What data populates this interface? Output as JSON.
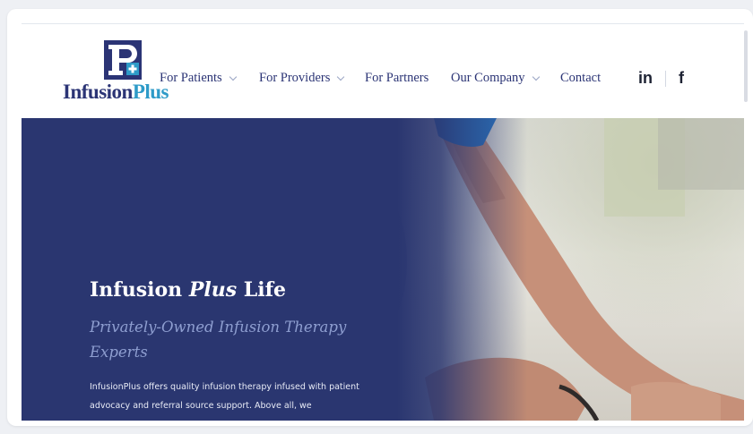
{
  "logo": {
    "name_part1": "Infusion",
    "name_part2": "Plus",
    "colors": {
      "navy": "#2b3475",
      "teal": "#2e9bc8"
    }
  },
  "nav": {
    "items": [
      {
        "label": "For Patients",
        "has_dropdown": true
      },
      {
        "label": "For Providers",
        "has_dropdown": true
      },
      {
        "label": "For Partners",
        "has_dropdown": false
      },
      {
        "label": "Our Company",
        "has_dropdown": true
      },
      {
        "label": "Contact",
        "has_dropdown": false
      }
    ]
  },
  "social": {
    "linkedin_label": "in",
    "facebook_label": "f",
    "icons": [
      "linkedin-icon",
      "facebook-icon"
    ]
  },
  "hero": {
    "title_before": "Infusion ",
    "title_emphasis": "Plus",
    "title_after": " Life",
    "subtitle": "Privately-Owned Infusion Therapy Experts",
    "body": "InfusionPlus offers quality infusion therapy infused with patient advocacy and referral source support. Above all, we",
    "colors": {
      "background": "#2a3670",
      "subtitle": "#8e9ed0"
    }
  }
}
